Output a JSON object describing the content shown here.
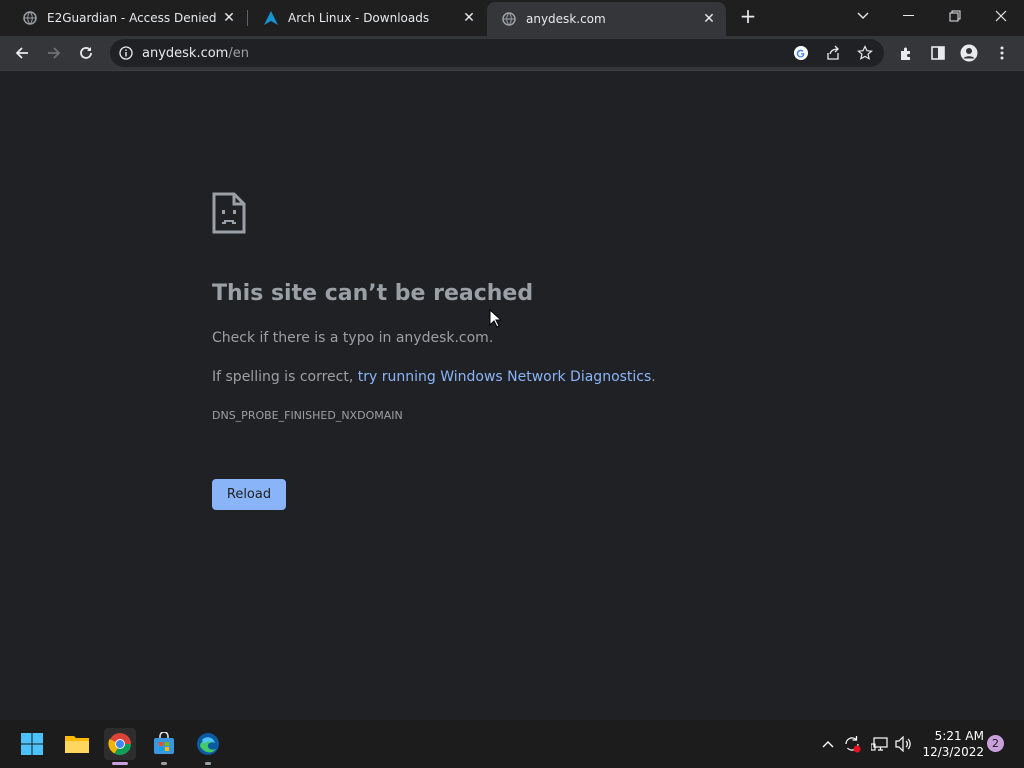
{
  "tabs": [
    {
      "title": "E2Guardian - Access Denied",
      "icon": "globe-icon",
      "active": false
    },
    {
      "title": "Arch Linux - Downloads",
      "icon": "arch-logo-icon",
      "active": false
    },
    {
      "title": "anydesk.com",
      "icon": "globe-icon",
      "active": true
    }
  ],
  "omnibox": {
    "host": "anydesk.com",
    "path": "/en"
  },
  "error": {
    "title": "This site can’t be reached",
    "line1": "Check if there is a typo in anydesk.com.",
    "line2_prefix": "If spelling is correct, ",
    "line2_link": "try running Windows Network Diagnostics",
    "line2_suffix": ".",
    "code": "DNS_PROBE_FINISHED_NXDOMAIN",
    "reload_label": "Reload"
  },
  "taskbar": {
    "apps": [
      "start-icon",
      "file-explorer-icon",
      "chrome-icon",
      "microsoft-store-icon",
      "edge-icon"
    ],
    "clock": {
      "time": "5:21 AM",
      "date": "12/3/2022"
    },
    "notification_count": "2"
  },
  "colors": {
    "accent": "#8ab4f8",
    "background": "#202124",
    "toolbar": "#35363a"
  }
}
